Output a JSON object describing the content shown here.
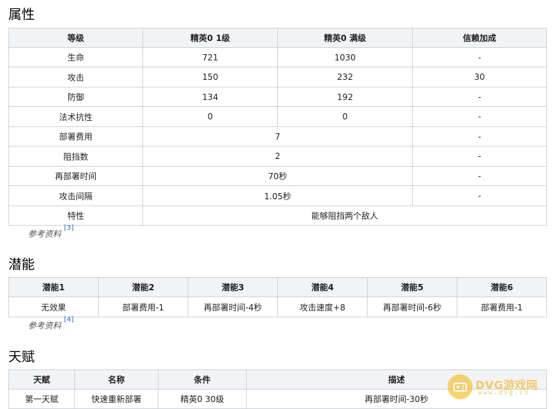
{
  "attributes": {
    "title": "属性",
    "headers": [
      "等级",
      "精英0 1级",
      "精英0 满级",
      "信赖加成"
    ],
    "rows": {
      "hp": {
        "label": "生命",
        "lv1": "721",
        "max": "1030",
        "trust": "-"
      },
      "atk": {
        "label": "攻击",
        "lv1": "150",
        "max": "232",
        "trust": "30"
      },
      "def": {
        "label": "防御",
        "lv1": "134",
        "max": "192",
        "trust": "-"
      },
      "res": {
        "label": "法术抗性",
        "lv1": "0",
        "max": "0",
        "trust": "-"
      },
      "cost": {
        "label": "部署费用",
        "value": "7",
        "trust": "-"
      },
      "block": {
        "label": "阻挡数",
        "value": "2",
        "trust": "-"
      },
      "redeploy": {
        "label": "再部署时间",
        "value": "70秒",
        "trust": "-"
      },
      "interval": {
        "label": "攻击间隔",
        "value": "1.05秒",
        "trust": "-"
      },
      "trait": {
        "label": "特性",
        "value": "能够阻挡两个敌人"
      }
    },
    "reference": {
      "label": "参考资料",
      "num": "[3]"
    }
  },
  "potential": {
    "title": "潜能",
    "headers": [
      "潜能1",
      "潜能2",
      "潜能3",
      "潜能4",
      "潜能5",
      "潜能6"
    ],
    "values": [
      "无效果",
      "部署费用-1",
      "再部署时间-4秒",
      "攻击速度+8",
      "再部署时间-6秒",
      "部署费用-1"
    ],
    "reference": {
      "label": "参考资料",
      "num": "[4]"
    }
  },
  "talent": {
    "title": "天赋",
    "headers": [
      "天赋",
      "名称",
      "条件",
      "描述"
    ],
    "row": {
      "slot": "第一天赋",
      "name": "快速重新部署",
      "cond": "精英0 30级",
      "desc": "再部署时间-30秒"
    }
  },
  "watermark": {
    "brand": "DVG游戏网",
    "site": "www.dvg.cn",
    "icon": "gamepad-icon"
  },
  "colors": {
    "header_bg": "#f2f3f5",
    "border": "#cfd3d7",
    "link": "#3366cc",
    "watermark": "#f5b400"
  }
}
